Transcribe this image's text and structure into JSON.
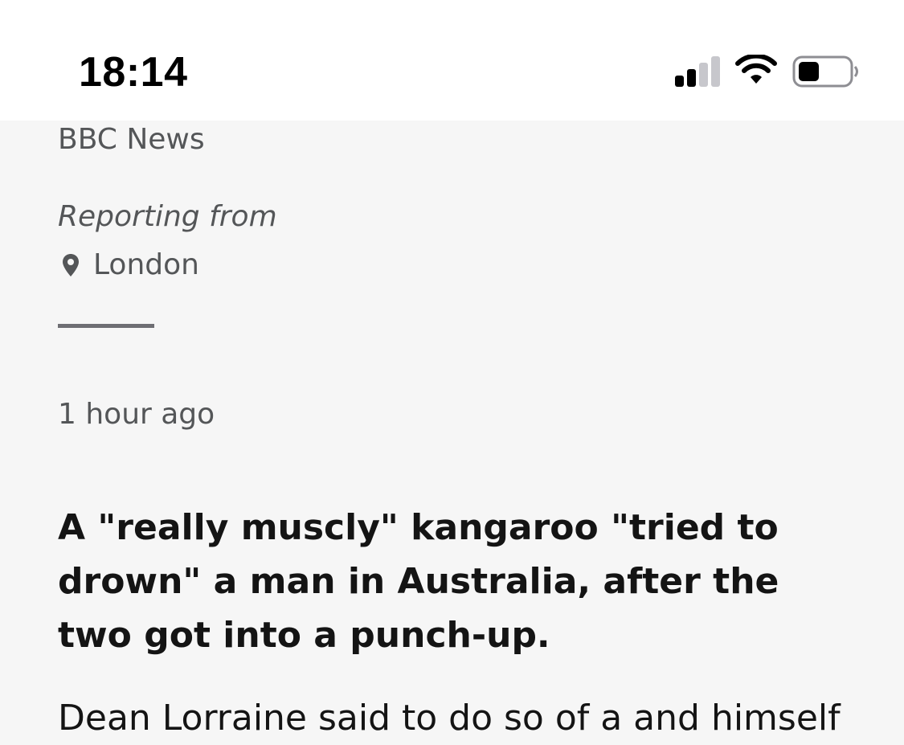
{
  "status_bar": {
    "time": "18:14",
    "signal_bars_active": 2,
    "signal_bars_total": 4,
    "battery_level": 0.3,
    "icons": [
      "signal-icon",
      "wifi-icon",
      "battery-icon"
    ]
  },
  "article": {
    "source": "BBC News",
    "reporting_label": "Reporting from",
    "location_icon": "location-pin-icon",
    "location": "London",
    "timestamp": "1 hour ago",
    "lede": "A \"really muscly\" kangaroo \"tried to drown\" a man in Australia, after the two got into a punch-up.",
    "body_first_line_partial": "Dean Lorraine said to do so of a and himself"
  },
  "colors": {
    "status_bar_bg": "#ffffff",
    "page_bg": "#f6f6f6",
    "meta_text": "#545658",
    "headline_text": "#141414",
    "divider": "#6e6e73"
  }
}
